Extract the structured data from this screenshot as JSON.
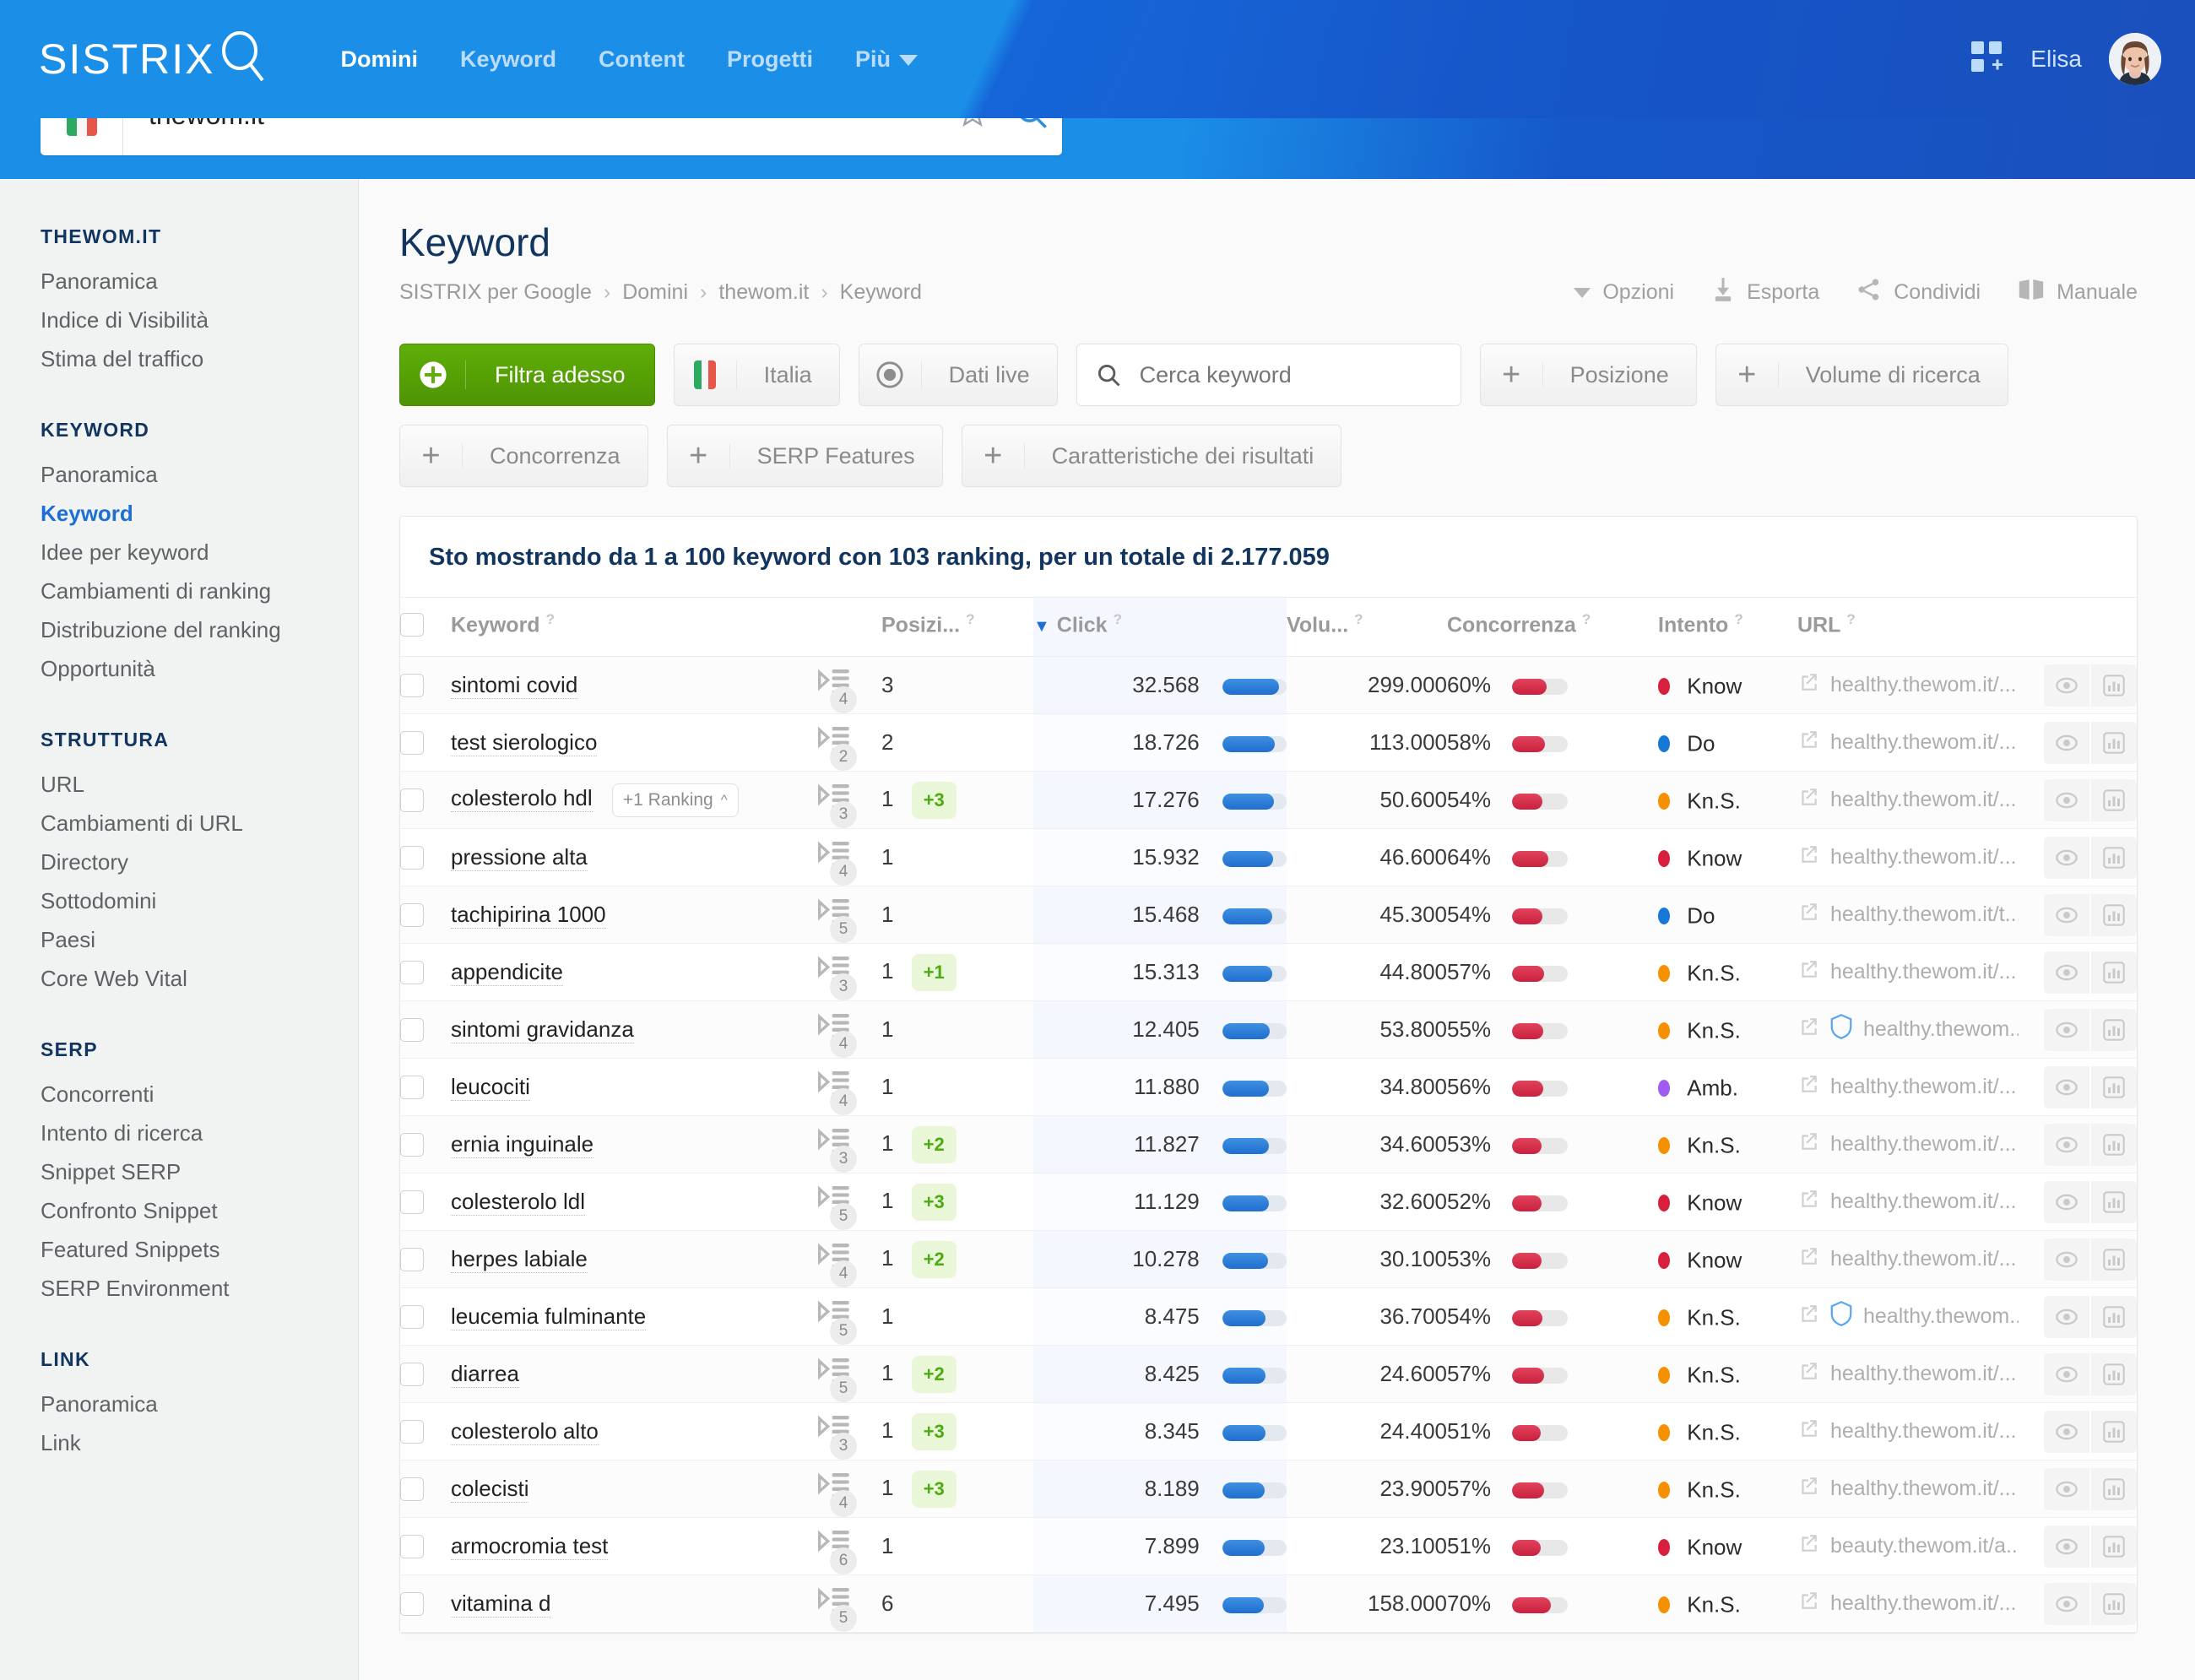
{
  "topnav": {
    "logo": "SISTRIX",
    "items": [
      {
        "label": "Domini",
        "active": true
      },
      {
        "label": "Keyword",
        "active": false
      },
      {
        "label": "Content",
        "active": false
      },
      {
        "label": "Progetti",
        "active": false
      },
      {
        "label": "Più",
        "active": false,
        "caret": true
      }
    ],
    "username": "Elisa",
    "grid_icon": "apps-grid-icon",
    "avatar_icon": "user-avatar"
  },
  "search": {
    "value": "thewom.it",
    "flag": "it-flag",
    "star_icon": "star-icon",
    "search_icon": "search-icon"
  },
  "sidebar": {
    "groups": [
      {
        "title": "THEWOM.IT",
        "items": [
          {
            "label": "Panoramica",
            "active": false
          },
          {
            "label": "Indice di Visibilità",
            "active": false
          },
          {
            "label": "Stima del traffico",
            "active": false
          }
        ]
      },
      {
        "title": "KEYWORD",
        "items": [
          {
            "label": "Panoramica",
            "active": false
          },
          {
            "label": "Keyword",
            "active": true
          },
          {
            "label": "Idee per keyword",
            "active": false
          },
          {
            "label": "Cambiamenti di ranking",
            "active": false
          },
          {
            "label": "Distribuzione del ranking",
            "active": false
          },
          {
            "label": "Opportunità",
            "active": false
          }
        ]
      },
      {
        "title": "STRUTTURA",
        "items": [
          {
            "label": "URL",
            "active": false
          },
          {
            "label": "Cambiamenti di URL",
            "active": false
          },
          {
            "label": "Directory",
            "active": false
          },
          {
            "label": "Sottodomini",
            "active": false
          },
          {
            "label": "Paesi",
            "active": false
          },
          {
            "label": "Core Web Vital",
            "active": false
          }
        ]
      },
      {
        "title": "SERP",
        "items": [
          {
            "label": "Concorrenti",
            "active": false
          },
          {
            "label": "Intento di ricerca",
            "active": false
          },
          {
            "label": "Snippet SERP",
            "active": false
          },
          {
            "label": "Confronto Snippet",
            "active": false
          },
          {
            "label": "Featured Snippets",
            "active": false
          },
          {
            "label": "SERP Environment",
            "active": false
          }
        ]
      },
      {
        "title": "LINK",
        "items": [
          {
            "label": "Panoramica",
            "active": false
          },
          {
            "label": "Link",
            "active": false
          }
        ]
      }
    ]
  },
  "page": {
    "title": "Keyword",
    "breadcrumb": [
      "SISTRIX per Google",
      "Domini",
      "thewom.it",
      "Keyword"
    ],
    "actions": [
      {
        "label": "Opzioni",
        "icon": "caret-down-icon"
      },
      {
        "label": "Esporta",
        "icon": "download-icon"
      },
      {
        "label": "Condividi",
        "icon": "share-icon"
      },
      {
        "label": "Manuale",
        "icon": "book-icon"
      }
    ]
  },
  "filters": {
    "primary_label": "Filtra adesso",
    "primary_icon": "plus-circle-icon",
    "country_label": "Italia",
    "country_icon": "it-flag",
    "live_label": "Dati live",
    "live_icon": "radio-target-icon",
    "search_placeholder": "Cerca keyword",
    "search_icon": "search-icon",
    "chips": [
      {
        "label": "Posizione",
        "icon": "plus-icon"
      },
      {
        "label": "Volume di ricerca",
        "icon": "plus-icon"
      },
      {
        "label": "Concorrenza",
        "icon": "plus-icon"
      },
      {
        "label": "SERP Features",
        "icon": "plus-icon"
      },
      {
        "label": "Caratteristiche dei risultati",
        "icon": "plus-icon"
      }
    ]
  },
  "table": {
    "caption": "Sto mostrando da 1 a 100 keyword con 103 ranking, per un totale di 2.177.059",
    "columns": [
      "Keyword",
      "Posizi...",
      "Click",
      "Volu...",
      "Concorrenza",
      "Intento",
      "URL"
    ],
    "sort_column": "Click",
    "sort_direction": "desc",
    "rows": [
      {
        "keyword": "sintomi covid",
        "ranking_pill": null,
        "serp": "4",
        "position": "3",
        "delta": null,
        "clicks": "32.568",
        "click_pct": 88,
        "volume": "299.000",
        "competition": "60%",
        "comp_pct": 62,
        "intent": "Know",
        "intent_color": "#d81f3d",
        "url": "healthy.thewom.it/...",
        "shield": false
      },
      {
        "keyword": "test sierologico",
        "ranking_pill": null,
        "serp": "2",
        "position": "2",
        "delta": null,
        "clicks": "18.726",
        "click_pct": 82,
        "volume": "113.000",
        "competition": "58%",
        "comp_pct": 58,
        "intent": "Do",
        "intent_color": "#1878d8",
        "url": "healthy.thewom.it/...",
        "shield": false
      },
      {
        "keyword": "colesterolo hdl",
        "ranking_pill": "+1 Ranking",
        "serp": "3",
        "position": "1",
        "delta": "+3",
        "clicks": "17.276",
        "click_pct": 80,
        "volume": "50.600",
        "competition": "54%",
        "comp_pct": 54,
        "intent": "Kn.S.",
        "intent_color": "#f59000",
        "url": "healthy.thewom.it/...",
        "shield": false
      },
      {
        "keyword": "pressione alta",
        "ranking_pill": null,
        "serp": "4",
        "position": "1",
        "delta": null,
        "clicks": "15.932",
        "click_pct": 79,
        "volume": "46.600",
        "competition": "64%",
        "comp_pct": 64,
        "intent": "Know",
        "intent_color": "#d81f3d",
        "url": "healthy.thewom.it/...",
        "shield": false
      },
      {
        "keyword": "tachipirina 1000",
        "ranking_pill": null,
        "serp": "5",
        "position": "1",
        "delta": null,
        "clicks": "15.468",
        "click_pct": 78,
        "volume": "45.300",
        "competition": "54%",
        "comp_pct": 54,
        "intent": "Do",
        "intent_color": "#1878d8",
        "url": "healthy.thewom.it/t...",
        "shield": false
      },
      {
        "keyword": "appendicite",
        "ranking_pill": null,
        "serp": "3",
        "position": "1",
        "delta": "+1",
        "clicks": "15.313",
        "click_pct": 78,
        "volume": "44.800",
        "competition": "57%",
        "comp_pct": 57,
        "intent": "Kn.S.",
        "intent_color": "#f59000",
        "url": "healthy.thewom.it/...",
        "shield": false
      },
      {
        "keyword": "sintomi gravidanza",
        "ranking_pill": null,
        "serp": "4",
        "position": "1",
        "delta": null,
        "clicks": "12.405",
        "click_pct": 74,
        "volume": "53.800",
        "competition": "55%",
        "comp_pct": 55,
        "intent": "Kn.S.",
        "intent_color": "#f59000",
        "url": "healthy.thewom....",
        "shield": true
      },
      {
        "keyword": "leucociti",
        "ranking_pill": null,
        "serp": "4",
        "position": "1",
        "delta": null,
        "clicks": "11.880",
        "click_pct": 73,
        "volume": "34.800",
        "competition": "56%",
        "comp_pct": 56,
        "intent": "Amb.",
        "intent_color": "#a05bf0",
        "url": "healthy.thewom.it/...",
        "shield": false
      },
      {
        "keyword": "ernia inguinale",
        "ranking_pill": null,
        "serp": "3",
        "position": "1",
        "delta": "+2",
        "clicks": "11.827",
        "click_pct": 73,
        "volume": "34.600",
        "competition": "53%",
        "comp_pct": 53,
        "intent": "Kn.S.",
        "intent_color": "#f59000",
        "url": "healthy.thewom.it/...",
        "shield": false
      },
      {
        "keyword": "colesterolo ldl",
        "ranking_pill": null,
        "serp": "5",
        "position": "1",
        "delta": "+3",
        "clicks": "11.129",
        "click_pct": 72,
        "volume": "32.600",
        "competition": "52%",
        "comp_pct": 52,
        "intent": "Know",
        "intent_color": "#d81f3d",
        "url": "healthy.thewom.it/...",
        "shield": false
      },
      {
        "keyword": "herpes labiale",
        "ranking_pill": null,
        "serp": "4",
        "position": "1",
        "delta": "+2",
        "clicks": "10.278",
        "click_pct": 71,
        "volume": "30.100",
        "competition": "53%",
        "comp_pct": 53,
        "intent": "Know",
        "intent_color": "#d81f3d",
        "url": "healthy.thewom.it/...",
        "shield": false
      },
      {
        "keyword": "leucemia fulminante",
        "ranking_pill": null,
        "serp": "5",
        "position": "1",
        "delta": null,
        "clicks": "8.475",
        "click_pct": 67,
        "volume": "36.700",
        "competition": "54%",
        "comp_pct": 54,
        "intent": "Kn.S.",
        "intent_color": "#f59000",
        "url": "healthy.thewom....",
        "shield": true
      },
      {
        "keyword": "diarrea",
        "ranking_pill": null,
        "serp": "5",
        "position": "1",
        "delta": "+2",
        "clicks": "8.425",
        "click_pct": 67,
        "volume": "24.600",
        "competition": "57%",
        "comp_pct": 57,
        "intent": "Kn.S.",
        "intent_color": "#f59000",
        "url": "healthy.thewom.it/...",
        "shield": false
      },
      {
        "keyword": "colesterolo alto",
        "ranking_pill": null,
        "serp": "3",
        "position": "1",
        "delta": "+3",
        "clicks": "8.345",
        "click_pct": 67,
        "volume": "24.400",
        "competition": "51%",
        "comp_pct": 51,
        "intent": "Kn.S.",
        "intent_color": "#f59000",
        "url": "healthy.thewom.it/...",
        "shield": false
      },
      {
        "keyword": "colecisti",
        "ranking_pill": null,
        "serp": "4",
        "position": "1",
        "delta": "+3",
        "clicks": "8.189",
        "click_pct": 66,
        "volume": "23.900",
        "competition": "57%",
        "comp_pct": 57,
        "intent": "Kn.S.",
        "intent_color": "#f59000",
        "url": "healthy.thewom.it/...",
        "shield": false
      },
      {
        "keyword": "armocromia test",
        "ranking_pill": null,
        "serp": "6",
        "position": "1",
        "delta": null,
        "clicks": "7.899",
        "click_pct": 66,
        "volume": "23.100",
        "competition": "51%",
        "comp_pct": 51,
        "intent": "Know",
        "intent_color": "#d81f3d",
        "url": "beauty.thewom.it/a...",
        "shield": false
      },
      {
        "keyword": "vitamina d",
        "ranking_pill": null,
        "serp": "5",
        "position": "6",
        "delta": null,
        "clicks": "7.495",
        "click_pct": 65,
        "volume": "158.000",
        "competition": "70%",
        "comp_pct": 70,
        "intent": "Kn.S.",
        "intent_color": "#f59000",
        "url": "healthy.thewom.it/...",
        "shield": false
      }
    ]
  }
}
